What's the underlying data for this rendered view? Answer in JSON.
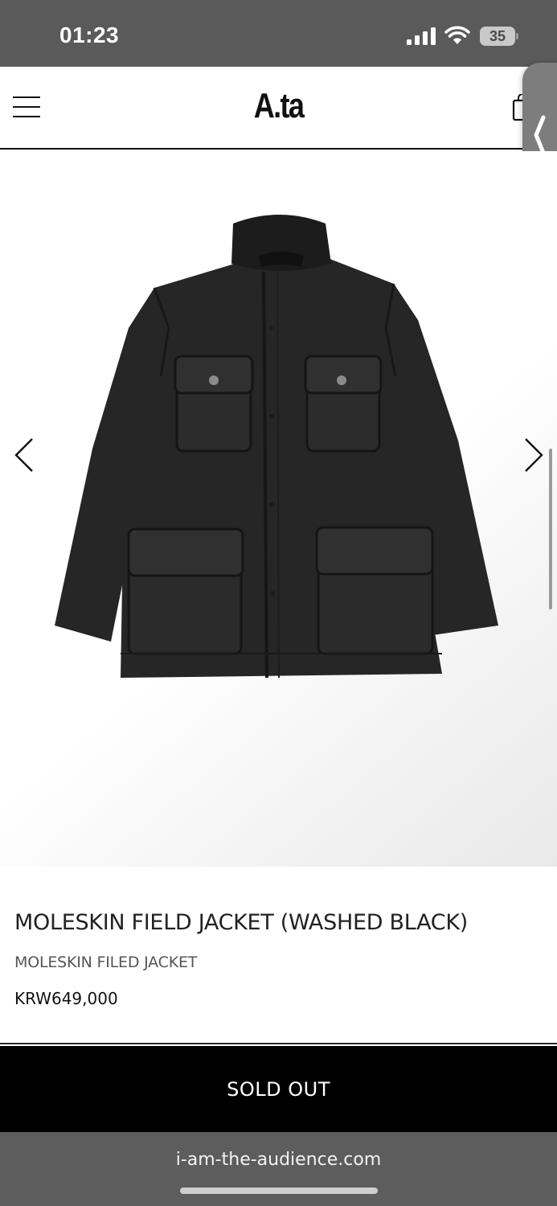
{
  "status_bar": {
    "time": "01:23",
    "battery": "35",
    "icons": [
      "signal-icon",
      "wifi-icon",
      "battery-icon"
    ]
  },
  "header": {
    "logo": "A.ta",
    "icons": [
      "hamburger-menu-icon",
      "shopping-bag-icon"
    ]
  },
  "gallery": {
    "image_subject": "jacket",
    "icons": [
      "chevron-left-icon",
      "chevron-right-icon"
    ]
  },
  "product": {
    "name": "MOLESKIN FIELD JACKET (WASHED BLACK)",
    "subtitle": "MOLESKIN FILED JACKET",
    "price": "KRW649,000"
  },
  "actions": {
    "sold_out_label": "SOLD OUT"
  },
  "browser": {
    "url": "i-am-the-audience.com"
  },
  "colors": {
    "button_bg": "#000000",
    "status_bar_bg": "#5a5a5a",
    "browser_bar_bg": "#5d5d5d",
    "jacket": "#262626"
  }
}
